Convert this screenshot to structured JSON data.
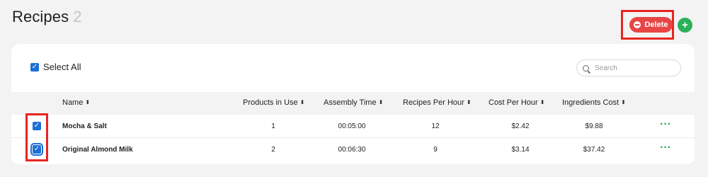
{
  "page": {
    "title": "Recipes",
    "count": "2"
  },
  "toolbar": {
    "delete_label": "Delete",
    "add_label": "+"
  },
  "list": {
    "select_all_label": "Select All",
    "search_placeholder": "Search"
  },
  "table": {
    "columns": [
      "Name",
      "Products in Use",
      "Assembly Time",
      "Recipes Per Hour",
      "Cost Per Hour",
      "Ingredients Cost"
    ],
    "rows": [
      {
        "checked": true,
        "name": "Mocha & Salt",
        "products": "1",
        "assembly": "00:05:00",
        "rph": "12",
        "cph": "$2.42",
        "ingredients": "$9.88"
      },
      {
        "checked": true,
        "name": "Original Almond Milk",
        "products": "2",
        "assembly": "00:06:30",
        "rph": "9",
        "cph": "$3.14",
        "ingredients": "$37.42"
      }
    ]
  },
  "colors": {
    "delete": "#e84545",
    "add": "#2bb15a",
    "checkbox": "#1e6fd6",
    "highlight": "#e8251f"
  },
  "icons": {
    "checkbox": "checkmark-icon",
    "sort": "sort-icon",
    "more": "more-options-icon",
    "search": "search-icon"
  }
}
